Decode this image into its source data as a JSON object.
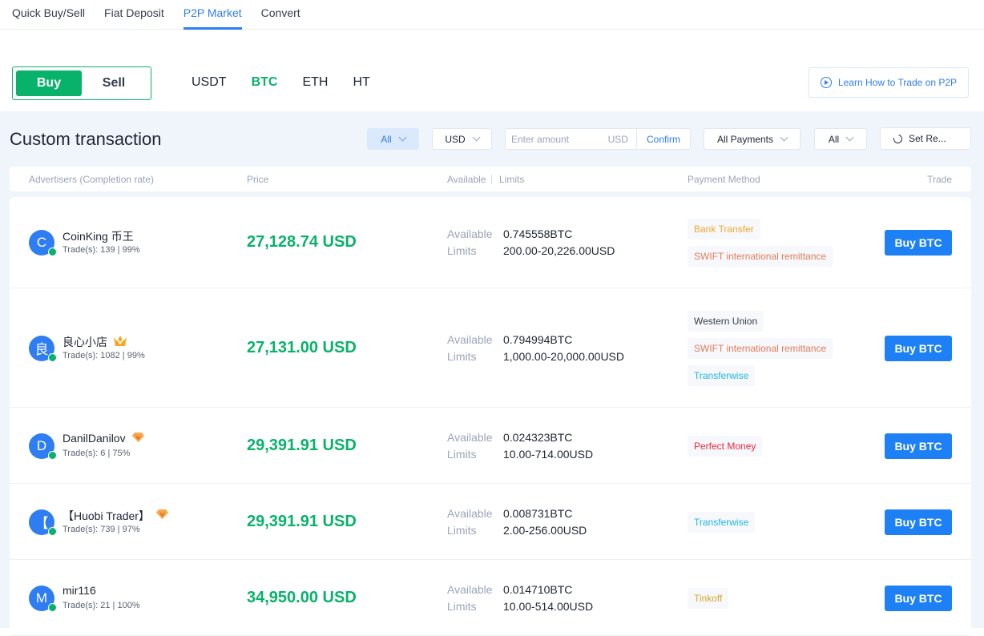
{
  "nav": {
    "tabs": [
      {
        "label": "Quick Buy/Sell",
        "active": false
      },
      {
        "label": "Fiat Deposit",
        "active": false
      },
      {
        "label": "P2P Market",
        "active": true
      },
      {
        "label": "Convert",
        "active": false
      }
    ]
  },
  "trade_side": {
    "buy": "Buy",
    "sell": "Sell",
    "selected": "Buy"
  },
  "coins": [
    {
      "label": "USDT",
      "active": false
    },
    {
      "label": "BTC",
      "active": true
    },
    {
      "label": "ETH",
      "active": false
    },
    {
      "label": "HT",
      "active": false
    }
  ],
  "learn_button": {
    "label": "Learn How to Trade on P2P",
    "icon": "play-circle-icon"
  },
  "section_title": "Custom transaction",
  "filters": {
    "type": "All",
    "currency": "USD",
    "amount_placeholder": "Enter amount",
    "amount_value": "",
    "amount_unit": "USD",
    "confirm": "Confirm",
    "payments": "All Payments",
    "other": "All",
    "reset": "Set Re..."
  },
  "table_headers": {
    "advertisers": "Advertisers (Completion rate)",
    "price": "Price",
    "available": "Available",
    "limits": "Limits",
    "payment": "Payment Method",
    "trade": "Trade"
  },
  "labels": {
    "available": "Available",
    "limits": "Limits"
  },
  "colors": {
    "green": "#08b26a",
    "blue": "#1e80f5",
    "bank": "#f0a830",
    "swift": "#e07b5a",
    "western": "#353d4d",
    "transferwise": "#1db7e9",
    "perfect": "#e8283e",
    "tinkoff": "#d4a72c"
  },
  "rows": [
    {
      "initial": "C",
      "name": "CoinKing 币王",
      "badge": "",
      "trades": "Trade(s): 139 | 99%",
      "price": "27,128.74 USD",
      "available": "0.745558BTC",
      "limits": "200.00-20,226.00USD",
      "payments": [
        {
          "label": "Bank Transfer",
          "color": "#f0a830"
        },
        {
          "label": "SWIFT international remittance",
          "color": "#e07b5a"
        }
      ],
      "action": "Buy BTC"
    },
    {
      "initial": "良",
      "name": "良心小店",
      "badge": "crown",
      "trades": "Trade(s): 1082 | 99%",
      "price": "27,131.00 USD",
      "available": "0.794994BTC",
      "limits": "1,000.00-20,000.00USD",
      "payments": [
        {
          "label": "Western Union",
          "color": "#353d4d"
        },
        {
          "label": "SWIFT international remittance",
          "color": "#e07b5a"
        },
        {
          "label": "Transferwise",
          "color": "#1db7e9"
        }
      ],
      "action": "Buy BTC"
    },
    {
      "initial": "D",
      "name": "DanilDanilov",
      "badge": "diamond",
      "trades": "Trade(s): 6 | 75%",
      "price": "29,391.91 USD",
      "available": "0.024323BTC",
      "limits": "10.00-714.00USD",
      "payments": [
        {
          "label": "Perfect Money",
          "color": "#e8283e"
        }
      ],
      "action": "Buy BTC"
    },
    {
      "initial": "【",
      "name": "【Huobi Trader】",
      "badge": "diamond",
      "trades": "Trade(s): 739 | 97%",
      "price": "29,391.91 USD",
      "available": "0.008731BTC",
      "limits": "2.00-256.00USD",
      "payments": [
        {
          "label": "Transferwise",
          "color": "#1db7e9"
        }
      ],
      "action": "Buy BTC"
    },
    {
      "initial": "M",
      "name": "mir116",
      "badge": "",
      "trades": "Trade(s): 21 | 100%",
      "price": "34,950.00 USD",
      "available": "0.014710BTC",
      "limits": "10.00-514.00USD",
      "payments": [
        {
          "label": "Tinkoff",
          "color": "#d4a72c"
        }
      ],
      "action": "Buy BTC"
    }
  ]
}
